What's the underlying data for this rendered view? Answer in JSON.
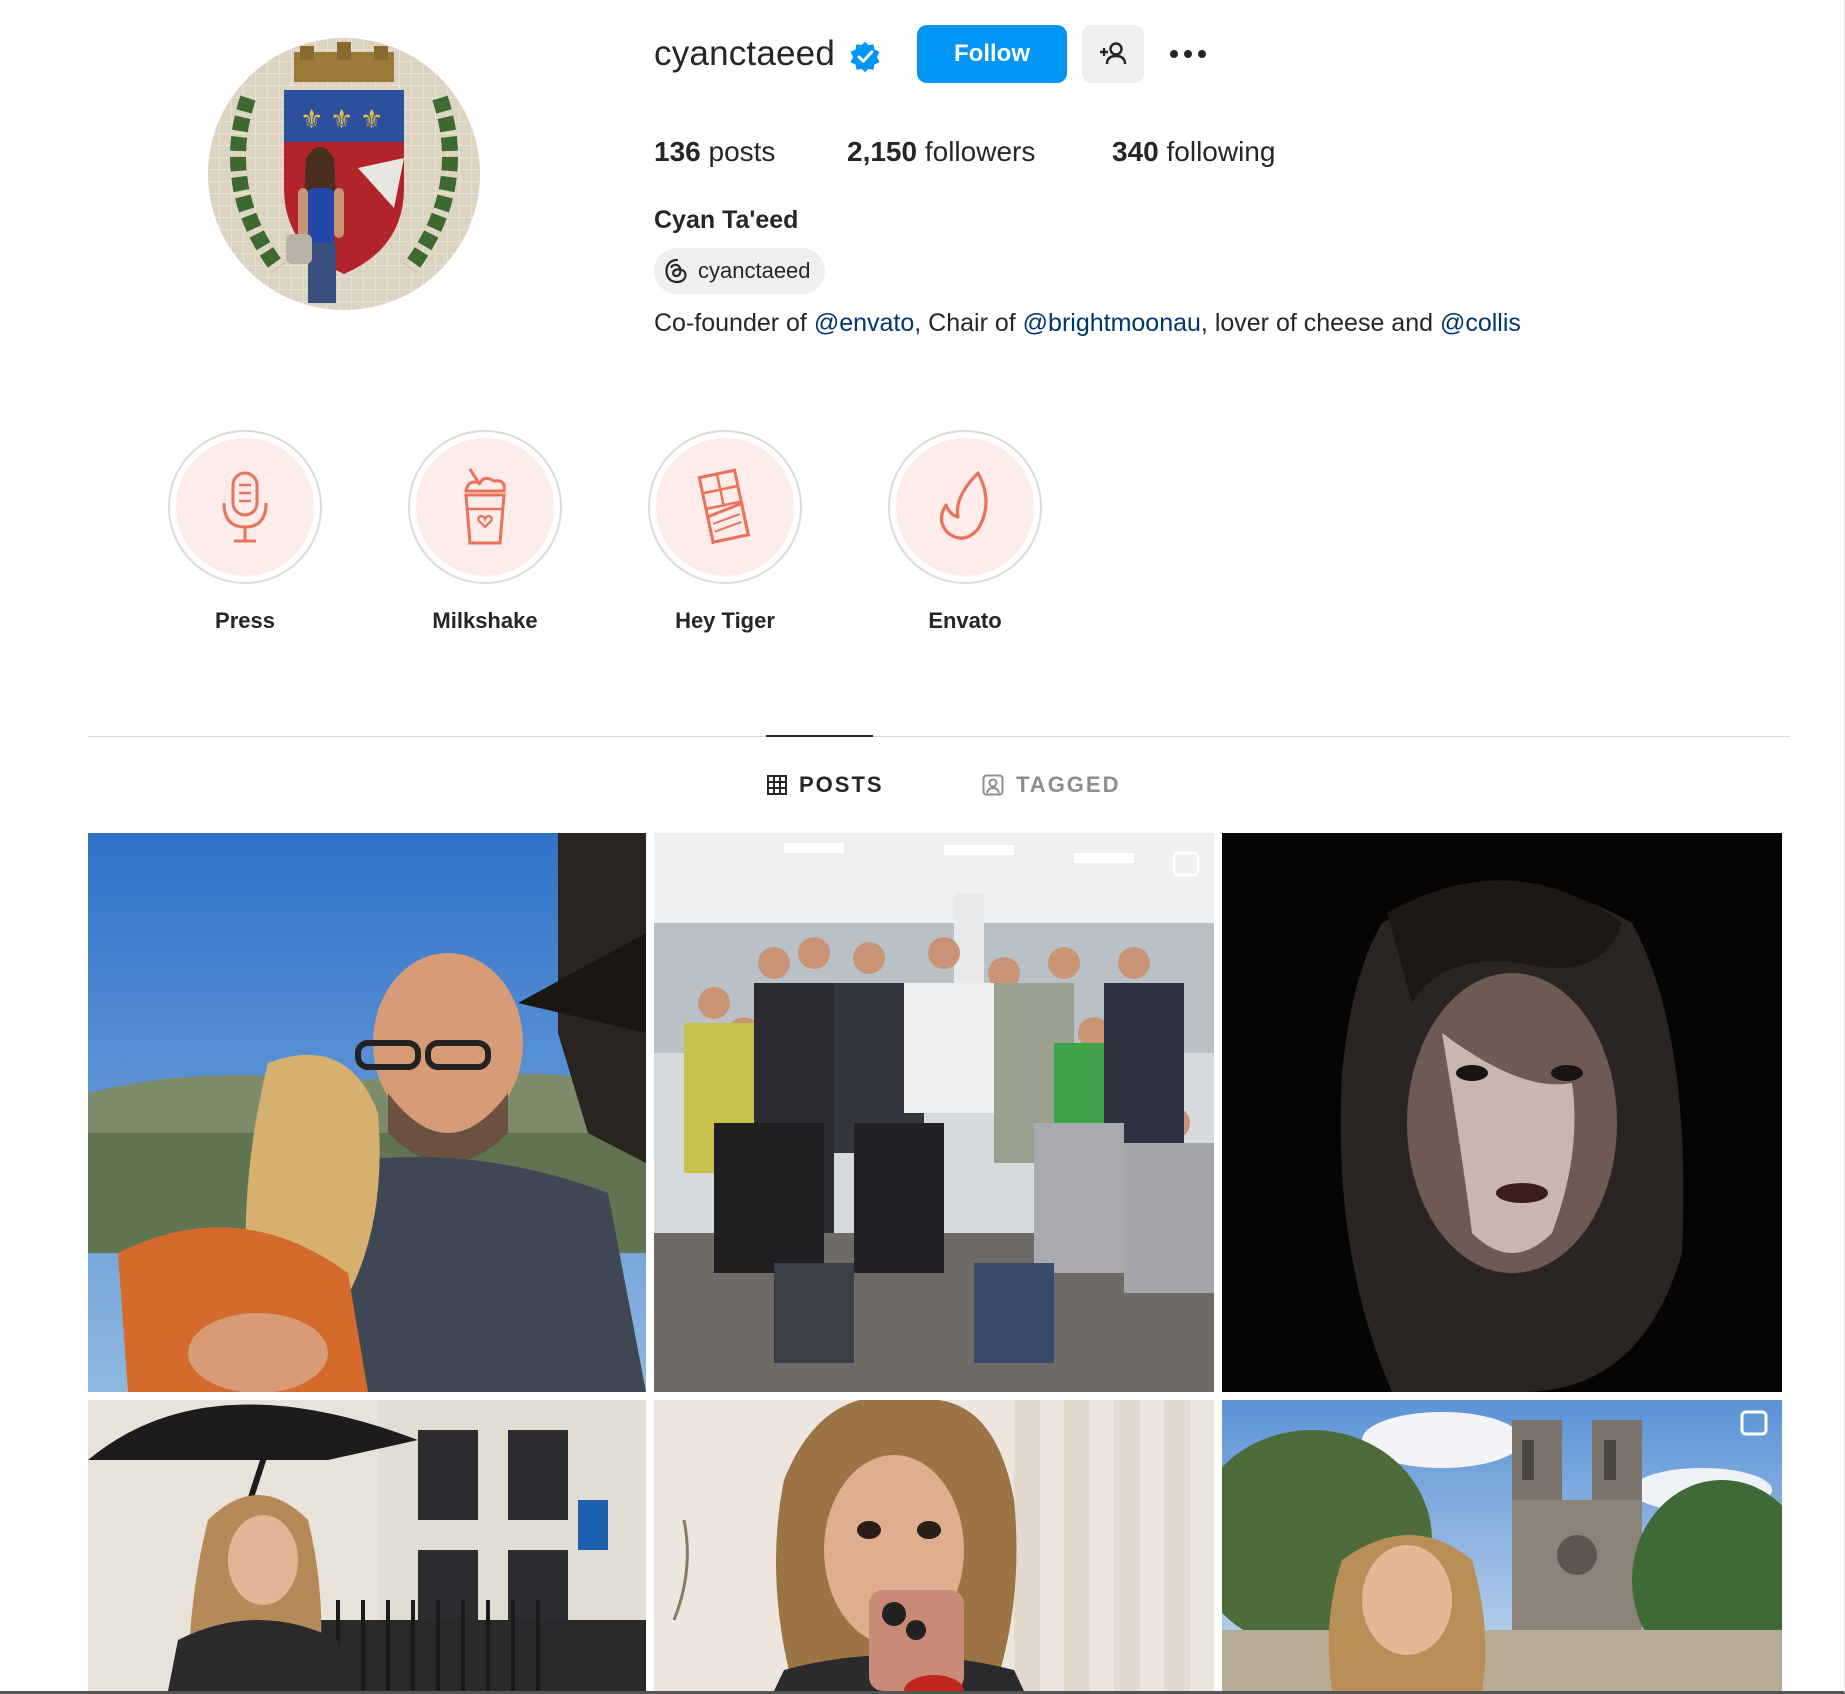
{
  "profile": {
    "username": "cyanctaeed",
    "follow_label": "Follow",
    "stats": {
      "posts_count": "136",
      "posts_label": "posts",
      "followers_count": "2,150",
      "followers_label": "followers",
      "following_count": "340",
      "following_label": "following"
    },
    "full_name": "Cyan Ta'eed",
    "threads_handle": "cyanctaeed",
    "bio": {
      "part1": "Co-founder of ",
      "link1": "@envato",
      "part2": ", Chair of ",
      "link2": "@brightmoonau",
      "part3": ", lover of cheese and ",
      "link3": "@collis"
    }
  },
  "highlights": [
    {
      "label": "Press",
      "icon": "microphone-icon"
    },
    {
      "label": "Milkshake",
      "icon": "milkshake-icon"
    },
    {
      "label": "Hey Tiger",
      "icon": "chocolate-bar-icon"
    },
    {
      "label": "Envato",
      "icon": "envato-leaf-icon"
    }
  ],
  "tabs": {
    "posts": "POSTS",
    "tagged": "TAGGED"
  },
  "colors": {
    "accent": "#0095f6",
    "link": "#00376b",
    "highlight_bg": "#fdecea",
    "highlight_icon": "#e8735a"
  }
}
